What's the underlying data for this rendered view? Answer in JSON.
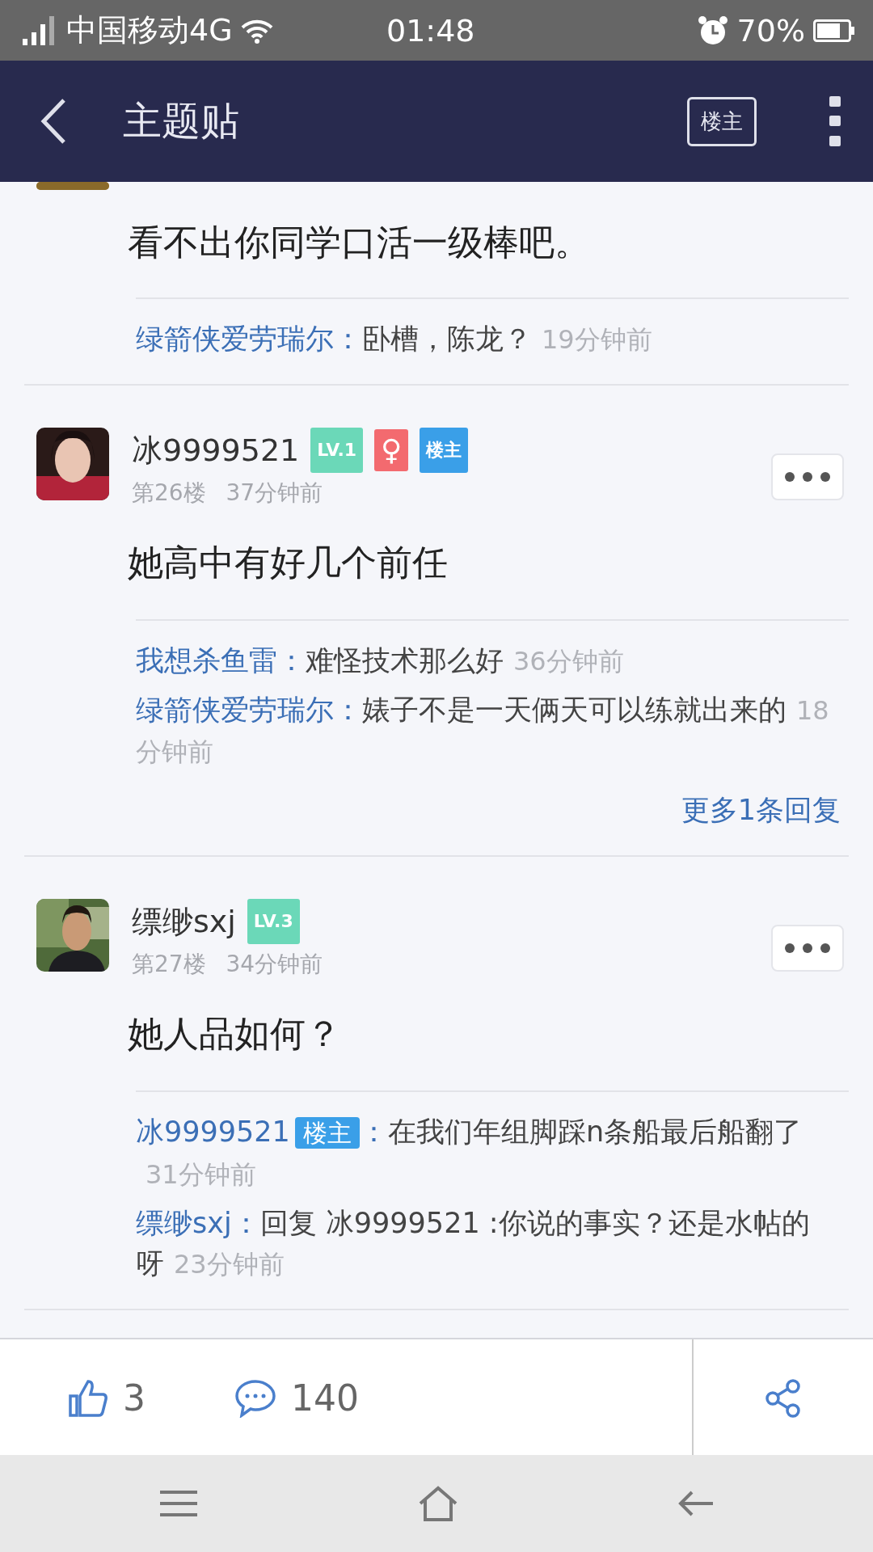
{
  "status_bar": {
    "carrier": "中国移动4G",
    "time": "01:48",
    "battery": "70%"
  },
  "nav": {
    "title": "主题贴",
    "owner_button": "楼主"
  },
  "posts": [
    {
      "kind": "partial",
      "content": "看不出你同学口活一级棒吧。",
      "replies": [
        {
          "user": "绿箭侠爱劳瑞尔：",
          "text": "卧槽，陈龙？",
          "time": "19分钟前"
        }
      ]
    },
    {
      "kind": "full",
      "user": "冰9999521",
      "badges": [
        {
          "kind": "level",
          "text": "LV.1"
        },
        {
          "kind": "gender",
          "text": "♀"
        },
        {
          "kind": "owner",
          "text": "楼主"
        }
      ],
      "floor": "第26楼",
      "time": "37分钟前",
      "content": "她高中有好几个前任",
      "replies": [
        {
          "user": "我想杀鱼雷：",
          "text": "难怪技术那么好",
          "time": "36分钟前"
        },
        {
          "user": "绿箭侠爱劳瑞尔：",
          "text": "婊子不是一天俩天可以练就出来的",
          "time": "18分钟前"
        }
      ],
      "more": "更多1条回复"
    },
    {
      "kind": "full",
      "user": "缥缈sxj",
      "badges": [
        {
          "kind": "level",
          "text": "LV.3"
        }
      ],
      "floor": "第27楼",
      "time": "34分钟前",
      "content": "她人品如何？",
      "replies": [
        {
          "user": "冰9999521",
          "badge": "楼主",
          "colon": "：",
          "text": "在我们年组脚踩n条船最后船翻了",
          "time": "31分钟前"
        },
        {
          "user": "缥缈sxj：",
          "text": "回复 冰9999521 :你说的事实？还是水帖的呀",
          "time": "23分钟前"
        }
      ]
    }
  ],
  "action_bar": {
    "likes": "3",
    "comments": "140"
  }
}
